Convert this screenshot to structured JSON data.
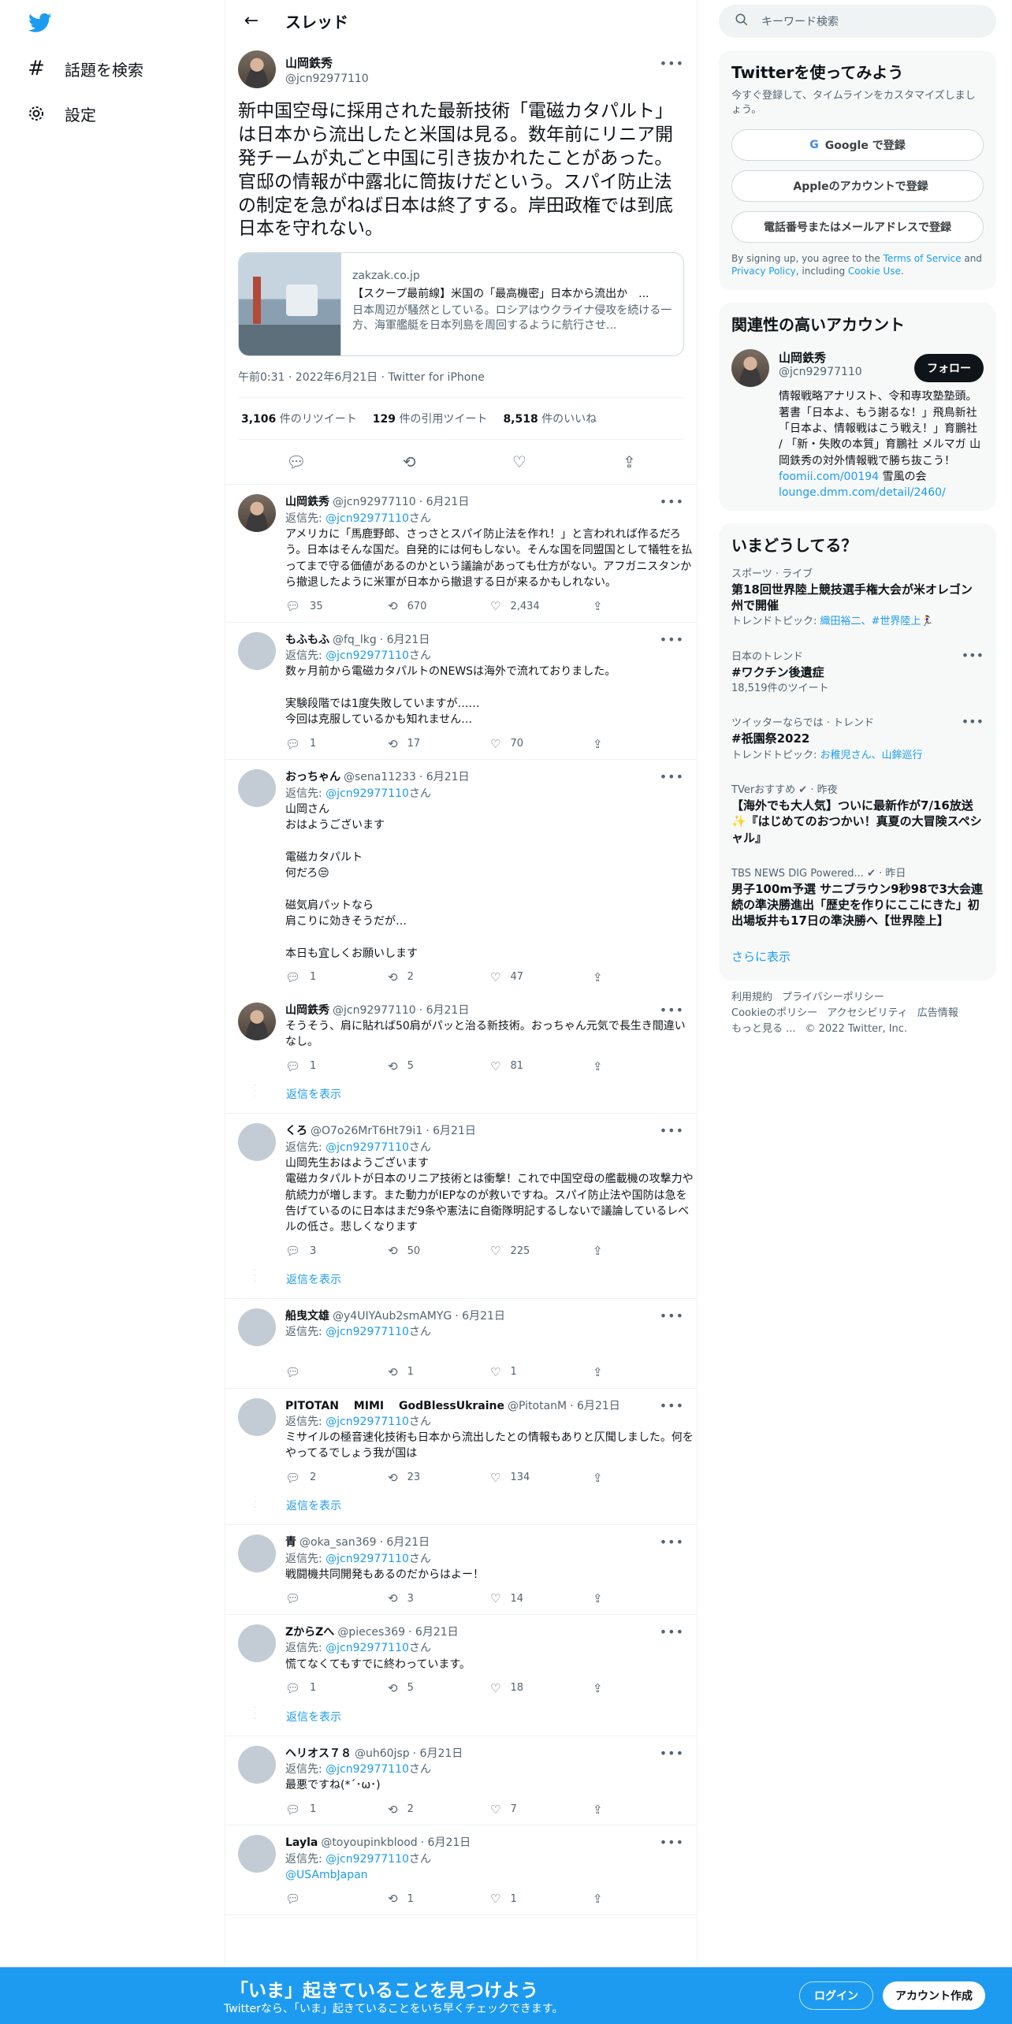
{
  "nav": {
    "explore": "話題を検索",
    "settings": "設定"
  },
  "header": {
    "title": "スレッド"
  },
  "focal": {
    "name": "山岡鉄秀",
    "handle": "@jcn92977110",
    "text": "新中国空母に採用された最新技術「電磁カタパルト」は日本から流出したと米国は見る。数年前にリニア開発チームが丸ごと中国に引き抜かれたことがあった。官邸の情報が中露北に筒抜けだという。スパイ防止法の制定を急がねば日本は終了する。岸田政権では到底日本を守れない。",
    "card": {
      "domain": "zakzak.co.jp",
      "title": "【スクープ最前線】米国の「最高機密」日本から流出か　...",
      "desc": "日本周辺が騒然としている。ロシアはウクライナ侵攻を続ける一方、海軍艦艇を日本列島を周回するように航行させ..."
    },
    "meta": "午前0:31 · 2022年6月21日 · Twitter for iPhone",
    "retweets": "3,106",
    "retweets_label": "件のリツイート",
    "quotes": "129",
    "quotes_label": "件の引用ツイート",
    "likes": "8,518",
    "likes_label": "件のいいね"
  },
  "replies": [
    {
      "name": "山岡鉄秀",
      "handle": "@jcn92977110",
      "date": "· 6月21日",
      "avatar": "photo",
      "reply_prefix": "返信先: ",
      "reply_to": "@jcn92977110",
      "reply_suffix": "さん",
      "text": "アメリカに「馬鹿野郎、さっさとスパイ防止法を作れ！」と言われれば作るだろう。日本はそんな国だ。自発的には何もしない。そんな国を同盟国として犠牲を払ってまで守る価値があるのかという議論があっても仕方がない。アフガニスタンから撤退したように米軍が日本から撤退する日が来るかもしれない。",
      "replies": "35",
      "retweets": "670",
      "likes": "2,434"
    },
    {
      "name": "もふもふ",
      "handle": "@fq_lkg",
      "date": "· 6月21日",
      "avatar": "blank",
      "reply_prefix": "返信先: ",
      "reply_to": "@jcn92977110",
      "reply_suffix": "さん",
      "text": "数ヶ月前から電磁カタパルトのNEWSは海外で流れておりました。\n\n実験段階では1度失敗していますが……\n今回は克服しているかも知れません…",
      "replies": "1",
      "retweets": "17",
      "likes": "70"
    },
    {
      "name": "おっちゃん",
      "handle": "@sena11233",
      "date": "· 6月21日",
      "avatar": "blank",
      "reply_prefix": "返信先: ",
      "reply_to": "@jcn92977110",
      "reply_suffix": "さん",
      "text": "山岡さん\nおはようございます\n\n電磁カタパルト\n何だろ😒\n\n磁気肩パットなら\n肩こりに効きそうだが…\n\n本日も宜しくお願いします",
      "replies": "1",
      "retweets": "2",
      "likes": "47"
    },
    {
      "name": "山岡鉄秀",
      "handle": "@jcn92977110",
      "date": "· 6月21日",
      "avatar": "photo",
      "reply_prefix": "",
      "reply_to": "",
      "reply_suffix": "",
      "text": "そうそう、肩に貼れば50肩がパッと治る新技術。おっちゃん元気で長生き間違いなし。",
      "replies": "1",
      "retweets": "5",
      "likes": "81"
    },
    {
      "name": "くろ",
      "handle": "@O7o26MrT6Ht79i1",
      "date": "· 6月21日",
      "avatar": "blank",
      "reply_prefix": "返信先: ",
      "reply_to": "@jcn92977110",
      "reply_suffix": "さん",
      "text": "山岡先生おはようございます\n電磁カタパルトが日本のリニア技術とは衝撃！これで中国空母の艦載機の攻撃力や航続力が増します。また動力がIEPなのが救いですね。スパイ防止法や国防は急を告げているのに日本はまだ9条や憲法に自衛隊明記するしないで議論しているレベルの低さ。悲しくなります",
      "replies": "3",
      "retweets": "50",
      "likes": "225"
    },
    {
      "name": "船曳文雄",
      "handle": "@y4UIYAub2smAMYG",
      "date": "· 6月21日",
      "avatar": "blank",
      "reply_prefix": "返信先: ",
      "reply_to": "@jcn92977110",
      "reply_suffix": "さん",
      "text": "",
      "replies": "",
      "retweets": "1",
      "likes": "1"
    },
    {
      "name": "PITOTAN　 MIMI　 GodBlessUkraine",
      "handle": "@PitotanM",
      "date": "· 6月21日",
      "avatar": "blank",
      "reply_prefix": "返信先: ",
      "reply_to": "@jcn92977110",
      "reply_suffix": "さん",
      "text": "ミサイルの極音速化技術も日本から流出したとの情報もありと仄聞しました。何をやってるでしょう我が国は",
      "replies": "2",
      "retweets": "23",
      "likes": "134"
    },
    {
      "name": "青",
      "handle": "@oka_san369",
      "date": "· 6月21日",
      "avatar": "blank",
      "reply_prefix": "返信先: ",
      "reply_to": "@jcn92977110",
      "reply_suffix": "さん",
      "text": "戦闘機共同開発もあるのだからはよー！",
      "replies": "",
      "retweets": "3",
      "likes": "14"
    },
    {
      "name": "ZからZへ",
      "handle": "@pieces369",
      "date": "· 6月21日",
      "avatar": "blank",
      "reply_prefix": "返信先: ",
      "reply_to": "@jcn92977110",
      "reply_suffix": "さん",
      "text": "慌てなくてもすでに終わっています。",
      "replies": "1",
      "retweets": "5",
      "likes": "18"
    },
    {
      "name": "ヘリオス７８",
      "handle": "@uh60jsp",
      "date": "· 6月21日",
      "avatar": "blank",
      "reply_prefix": "返信先: ",
      "reply_to": "@jcn92977110",
      "reply_suffix": "さん",
      "text": "最悪ですね(*´･ω･)",
      "replies": "1",
      "retweets": "2",
      "likes": "7"
    },
    {
      "name": "Layla",
      "handle": "@toyoupinkblood",
      "date": "· 6月21日",
      "avatar": "blank",
      "reply_prefix": "返信先: ",
      "reply_to": "@jcn92977110",
      "reply_suffix": "さん",
      "text": "",
      "mention": "@USAmbJapan",
      "replies": "",
      "retweets": "1",
      "likes": "1"
    }
  ],
  "show_replies_label": "返信を表示",
  "right": {
    "search_placeholder": "キーワード検索",
    "signup": {
      "title": "Twitterを使ってみよう",
      "sub": "今すぐ登録して、タイムラインをカスタマイズしましょう。",
      "google": "Google で登録",
      "apple": "Appleのアカウントで登録",
      "phone": "電話番号またはメールアドレスで登録",
      "legal_1": "By signing up, you agree to the ",
      "terms": "Terms of Service",
      "legal_2": " and ",
      "privacy": "Privacy Policy",
      "legal_3": ", including ",
      "cookie": "Cookie Use",
      "legal_4": "."
    },
    "related": {
      "title": "関連性の高いアカウント",
      "name": "山岡鉄秀",
      "handle": "@jcn92977110",
      "follow": "フォロー",
      "bio": "情報戦略アナリスト、令和専攻塾塾頭。著書「日本よ、もう謝るな！」飛鳥新社「日本よ、情報戦はこう戦え！」育鵬社 / 「新・失敗の本質」育鵬社 メルマガ 山岡鉄秀の対外情報戦で勝ち抜こう！ ",
      "link1": "foomii.com/00194",
      "bio2": " 雪風の会",
      "link2": "lounge.dmm.com/detail/2460/"
    },
    "trends": {
      "title": "いまどうしてる？",
      "items": [
        {
          "ctx": "スポーツ · ライブ",
          "name": "第18回世界陸上競技選手権大会が米オレゴン州で開催",
          "cnt": "トレンドトピック: ",
          "topic": "織田裕二、#世界陸上🏃‍♀️"
        },
        {
          "ctx": "日本のトレンド",
          "name": "#ワクチン後遺症",
          "cnt": "18,519件のツイート"
        },
        {
          "ctx": "ツイッターならでは · トレンド",
          "name": "#祇園祭2022",
          "cnt": "トレンドトピック: ",
          "topic": "お稚児さん、山鉾巡行"
        },
        {
          "ctx": "TVerおすすめ ✔ · 昨夜",
          "name": "【海外でも大人気】ついに最新作が7/16放送✨『はじめてのおつかい！真夏の大冒険スペシャル』"
        },
        {
          "ctx": "TBS NEWS DIG Powered... ✔ · 昨日",
          "name": "男子100m予選 サニブラウン9秒98で3大会連続の準決勝進出「歴史を作りにここにきた」初出場坂井も17日の準決勝へ【世界陸上】"
        }
      ],
      "show_more": "さらに表示"
    },
    "footer": {
      "links": [
        "利用規約",
        "プライバシーポリシー",
        "Cookieのポリシー",
        "アクセシビリティ",
        "広告情報",
        "もっと見る ...",
        "© 2022 Twitter, Inc."
      ]
    }
  },
  "bottombar": {
    "title": "「いま」起きていることを見つけよう",
    "sub": "Twitterなら、「いま」起きていることをいち早くチェックできます。",
    "login": "ログイン",
    "signup": "アカウント作成"
  }
}
